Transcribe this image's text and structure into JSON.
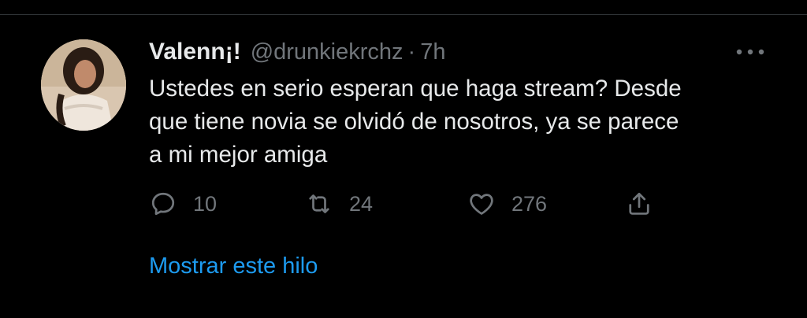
{
  "tweet": {
    "display_name": "Valenn¡!",
    "handle": "@drunkiekrchz",
    "separator": "·",
    "time": "7h",
    "text_lines": [
      "Ustedes en serio esperan que haga stream? Desde",
      "que tiene novia se olvidó de nosotros, ya se parece",
      "a mi mejor amiga"
    ]
  },
  "actions": {
    "reply": {
      "icon": "reply-icon",
      "count": "10"
    },
    "retweet": {
      "icon": "retweet-icon",
      "count": "24"
    },
    "like": {
      "icon": "heart-icon",
      "count": "276"
    },
    "share": {
      "icon": "share-icon"
    }
  },
  "show_thread_label": "Mostrar este hilo",
  "colors": {
    "background": "#000000",
    "text_primary": "#e7e9ea",
    "text_secondary": "#71767b",
    "link": "#1d9bf0",
    "divider": "#2f3336"
  }
}
